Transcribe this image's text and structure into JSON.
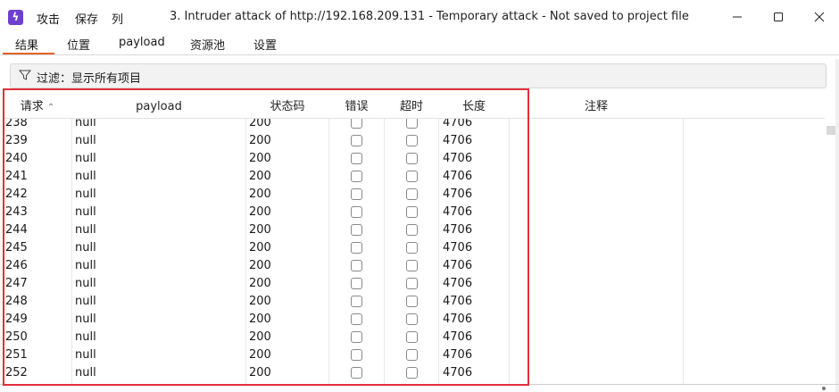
{
  "window": {
    "menu": [
      "攻击",
      "保存",
      "列"
    ],
    "title": "3. Intruder attack of http://192.168.209.131 - Temporary attack - Not saved to project file"
  },
  "tabs": [
    "结果",
    "位置",
    "payload",
    "资源池",
    "设置"
  ],
  "filter": {
    "label": "过滤：显示所有项目"
  },
  "table": {
    "columns": {
      "request": "请求",
      "payload": "payload",
      "status": "状态码",
      "error": "错误",
      "timeout": "超时",
      "length": "长度",
      "comment": "注释"
    },
    "sort_indicator": "^",
    "rows": [
      {
        "request": "238",
        "payload": "null",
        "status": "200",
        "error": false,
        "timeout": false,
        "length": "4706",
        "comment": ""
      },
      {
        "request": "239",
        "payload": "null",
        "status": "200",
        "error": false,
        "timeout": false,
        "length": "4706",
        "comment": ""
      },
      {
        "request": "240",
        "payload": "null",
        "status": "200",
        "error": false,
        "timeout": false,
        "length": "4706",
        "comment": ""
      },
      {
        "request": "241",
        "payload": "null",
        "status": "200",
        "error": false,
        "timeout": false,
        "length": "4706",
        "comment": ""
      },
      {
        "request": "242",
        "payload": "null",
        "status": "200",
        "error": false,
        "timeout": false,
        "length": "4706",
        "comment": ""
      },
      {
        "request": "243",
        "payload": "null",
        "status": "200",
        "error": false,
        "timeout": false,
        "length": "4706",
        "comment": ""
      },
      {
        "request": "244",
        "payload": "null",
        "status": "200",
        "error": false,
        "timeout": false,
        "length": "4706",
        "comment": ""
      },
      {
        "request": "245",
        "payload": "null",
        "status": "200",
        "error": false,
        "timeout": false,
        "length": "4706",
        "comment": ""
      },
      {
        "request": "246",
        "payload": "null",
        "status": "200",
        "error": false,
        "timeout": false,
        "length": "4706",
        "comment": ""
      },
      {
        "request": "247",
        "payload": "null",
        "status": "200",
        "error": false,
        "timeout": false,
        "length": "4706",
        "comment": ""
      },
      {
        "request": "248",
        "payload": "null",
        "status": "200",
        "error": false,
        "timeout": false,
        "length": "4706",
        "comment": ""
      },
      {
        "request": "249",
        "payload": "null",
        "status": "200",
        "error": false,
        "timeout": false,
        "length": "4706",
        "comment": ""
      },
      {
        "request": "250",
        "payload": "null",
        "status": "200",
        "error": false,
        "timeout": false,
        "length": "4706",
        "comment": ""
      },
      {
        "request": "251",
        "payload": "null",
        "status": "200",
        "error": false,
        "timeout": false,
        "length": "4706",
        "comment": ""
      },
      {
        "request": "252",
        "payload": "null",
        "status": "200",
        "error": false,
        "timeout": false,
        "length": "4706",
        "comment": ""
      }
    ]
  },
  "colors": {
    "accent": "#e2622b",
    "highlight_box": "#e0303a",
    "app_icon": "#6d3fd1"
  },
  "icons": {
    "app": "burp-bolt-icon",
    "filter": "funnel-icon",
    "minimize": "minimize-icon",
    "maximize": "maximize-icon",
    "close": "close-icon"
  }
}
